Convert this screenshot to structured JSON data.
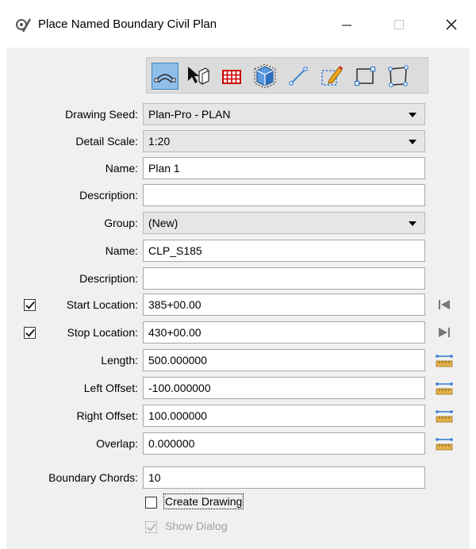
{
  "window": {
    "title": "Place Named Boundary Civil Plan",
    "icons": {
      "app": "gear-pencil-icon",
      "minimize": "minimize-icon",
      "maximize": "maximize-icon",
      "close": "close-icon"
    }
  },
  "toolbar": {
    "tools": [
      {
        "icon": "civil-plan-icon",
        "active": true
      },
      {
        "icon": "select-3d-icon",
        "active": false
      },
      {
        "icon": "grid-table-icon",
        "active": false
      },
      {
        "icon": "3d-box-icon",
        "active": false
      },
      {
        "icon": "line-icon",
        "active": false
      },
      {
        "icon": "edit-rectangle-icon",
        "active": false
      },
      {
        "icon": "rectangle-icon",
        "active": false
      },
      {
        "icon": "shape-icon",
        "active": false
      }
    ]
  },
  "form": {
    "drawing_seed": {
      "label": "Drawing Seed:",
      "value": "Plan-Pro - PLAN"
    },
    "detail_scale": {
      "label": "Detail Scale:",
      "value": "1:20"
    },
    "name": {
      "label": "Name:",
      "value": "Plan 1"
    },
    "description": {
      "label": "Description:",
      "value": ""
    },
    "group": {
      "label": "Group:",
      "value": "(New)"
    },
    "name2": {
      "label": "Name:",
      "value": "CLP_S185"
    },
    "description2": {
      "label": "Description:",
      "value": ""
    },
    "start_location": {
      "label": "Start Location:",
      "value": "385+00.00",
      "checked": true
    },
    "stop_location": {
      "label": "Stop Location:",
      "value": "430+00.00",
      "checked": true
    },
    "length": {
      "label": "Length:",
      "value": "500.000000"
    },
    "left_offset": {
      "label": "Left Offset:",
      "value": "-100.000000"
    },
    "right_offset": {
      "label": "Right Offset:",
      "value": "100.000000"
    },
    "overlap": {
      "label": "Overlap:",
      "value": "0.000000"
    },
    "boundary_chords": {
      "label": "Boundary Chords:",
      "value": "10"
    },
    "create_drawing": {
      "label": "Create Drawing",
      "checked": false
    },
    "show_dialog": {
      "label": "Show Dialog",
      "checked": true,
      "enabled": false
    }
  },
  "colors": {
    "accent": "#3d85c6",
    "active_tool_bg": "#8fbee8",
    "measure_icon": "#2e7bd6",
    "ruler": "#e2b04a"
  }
}
